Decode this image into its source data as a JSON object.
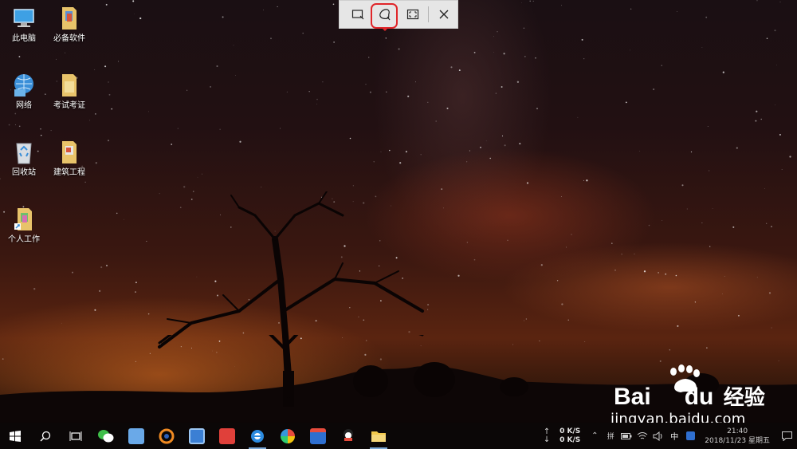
{
  "desktop_icons": [
    {
      "label": "此电脑",
      "icon": "computer-icon"
    },
    {
      "label": "必备软件",
      "icon": "folder-icon"
    },
    {
      "label": "网络",
      "icon": "network-icon"
    },
    {
      "label": "考试考证",
      "icon": "folder-icon"
    },
    {
      "label": "回收站",
      "icon": "recycle-bin-icon"
    },
    {
      "label": "建筑工程",
      "icon": "folder-icon"
    },
    {
      "label": "个人工作",
      "icon": "folder-shortcut-icon"
    }
  ],
  "snip_toolbar": {
    "buttons": [
      {
        "name": "rectangular-snip",
        "icon": "rectangle-snip-icon"
      },
      {
        "name": "freeform-snip",
        "icon": "freeform-snip-icon",
        "highlighted": true
      },
      {
        "name": "fullscreen-snip",
        "icon": "fullscreen-snip-icon"
      },
      {
        "name": "close",
        "icon": "close-icon"
      }
    ],
    "highlight_color": "#e0262a"
  },
  "watermark": {
    "brand": "Bai",
    "brand_tail": "du",
    "cn": "经验",
    "url": "jingyan.baidu.com"
  },
  "taskbar": {
    "apps": [
      {
        "name": "start",
        "icon": "windows-icon"
      },
      {
        "name": "search",
        "icon": "search-icon"
      },
      {
        "name": "task-view",
        "icon": "task-view-icon"
      },
      {
        "name": "wechat",
        "icon": "wechat-icon"
      },
      {
        "name": "app-bird",
        "icon": "bird-app-icon"
      },
      {
        "name": "app-orange-ring",
        "icon": "orange-ring-app-icon"
      },
      {
        "name": "app-blue-box",
        "icon": "blue-box-app-icon"
      },
      {
        "name": "app-it",
        "icon": "it-app-icon"
      },
      {
        "name": "browser",
        "icon": "ie-browser-icon",
        "active": true
      },
      {
        "name": "app-colorful",
        "icon": "colorful-app-icon"
      },
      {
        "name": "app-calendar",
        "icon": "calendar-app-icon"
      },
      {
        "name": "app-mascot",
        "icon": "mascot-app-icon"
      },
      {
        "name": "file-explorer",
        "icon": "file-explorer-icon",
        "active": true
      }
    ],
    "net_up": "0 K/S",
    "net_down": "0 K/S",
    "ime": "中",
    "time": "21:40",
    "date": "2018/11/23 星期五"
  },
  "colors": {
    "accent": "#7aa7d6",
    "taskbar_bg": "#0b0707"
  }
}
